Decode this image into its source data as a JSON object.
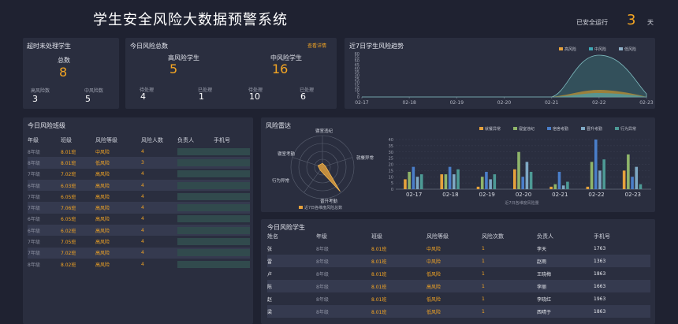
{
  "header": {
    "title": "学生安全风险大数据预警系统",
    "running_label": "已安全运行",
    "running_days": "3",
    "running_unit": "天"
  },
  "timeout": {
    "title": "超时未处理学生",
    "total_label": "总数",
    "total": "8",
    "high_label": "高风险数",
    "high": "3",
    "mid_label": "中风险数",
    "mid": "5"
  },
  "today_total": {
    "title": "今日风险总数",
    "detail_link": "查看详情",
    "high_label": "高风险学生",
    "high": "5",
    "mid_label": "中风险学生",
    "mid": "16",
    "high_pending_label": "待处理",
    "high_pending": "4",
    "high_done_label": "已处理",
    "high_done": "1",
    "mid_pending_label": "待处理",
    "mid_pending": "10",
    "mid_done_label": "已处理",
    "mid_done": "6"
  },
  "trend": {
    "title": "近7日学生风险趋势",
    "legend": [
      "高风险",
      "中风险",
      "低风险"
    ],
    "colors": [
      "#e6a23c",
      "#3fa7b5",
      "#8fb0c8"
    ],
    "x": [
      "02-17",
      "02-18",
      "02-19",
      "02-20",
      "02-21",
      "02-22",
      "02-23"
    ],
    "y_ticks": [
      "0",
      "5",
      "10",
      "15",
      "20",
      "25",
      "30",
      "35",
      "40",
      "45",
      "50",
      "55",
      "60"
    ]
  },
  "class_table": {
    "title": "今日风险班级",
    "headers": [
      "年级",
      "班级",
      "风险等级",
      "风险人数",
      "负责人",
      "手机号"
    ],
    "rows": [
      [
        "8年级",
        "8.01班",
        "中风险",
        "4"
      ],
      [
        "8年级",
        "8.01班",
        "低风险",
        "3"
      ],
      [
        "7年级",
        "7.02班",
        "高风险",
        "4"
      ],
      [
        "6年级",
        "6.03班",
        "高风险",
        "4"
      ],
      [
        "7年级",
        "6.05班",
        "高风险",
        "4"
      ],
      [
        "7年级",
        "7.06班",
        "高风险",
        "4"
      ],
      [
        "6年级",
        "6.05班",
        "高风险",
        "4"
      ],
      [
        "6年级",
        "6.02班",
        "高风险",
        "4"
      ],
      [
        "7年级",
        "7.05班",
        "高风险",
        "4"
      ],
      [
        "7年级",
        "7.02班",
        "高风险",
        "4"
      ],
      [
        "8年级",
        "8.02班",
        "高风险",
        "4"
      ]
    ]
  },
  "radar": {
    "title": "风险雷达",
    "axes": [
      "寝室违纪",
      "就餐异常",
      "晋升考勤",
      "行为异常",
      "寝室考勤"
    ],
    "legend": "近7日各维度风险总数"
  },
  "bar_chart": {
    "legend": [
      "就餐异常",
      "寝室违纪",
      "宿舍考勤",
      "晋升考勤",
      "行为异常"
    ],
    "colors": [
      "#e6a23c",
      "#8fb56a",
      "#4a7ec9",
      "#7ea9c4",
      "#4d9a95"
    ],
    "caption": "近7日各维度风险量"
  },
  "chart_data": {
    "type": "bar",
    "categories": [
      "02-17",
      "02-18",
      "02-19",
      "02-20",
      "02-21",
      "02-22",
      "02-23"
    ],
    "y_ticks": [
      "0",
      "5",
      "10",
      "15",
      "20",
      "25",
      "30",
      "35",
      "40"
    ],
    "ylim": [
      0,
      40
    ],
    "series": [
      {
        "name": "就餐异常",
        "values": [
          8,
          12,
          2,
          16,
          2,
          2,
          15
        ]
      },
      {
        "name": "寝室违纪",
        "values": [
          14,
          12,
          10,
          30,
          4,
          22,
          28
        ]
      },
      {
        "name": "宿舍考勤",
        "values": [
          18,
          18,
          14,
          10,
          14,
          40,
          10
        ]
      },
      {
        "name": "晋升考勤",
        "values": [
          10,
          12,
          8,
          22,
          3,
          15,
          18
        ]
      },
      {
        "name": "行为异常",
        "values": [
          12,
          16,
          12,
          14,
          6,
          24,
          4
        ]
      }
    ]
  },
  "student_table": {
    "title": "今日风险学生",
    "headers": [
      "姓名",
      "年级",
      "班级",
      "风险等级",
      "风险次数",
      "负责人",
      "手机号"
    ],
    "rows": [
      [
        "张",
        "8年级",
        "8.01班",
        "中风险",
        "1",
        "李天",
        "1763"
      ],
      [
        "雷",
        "8年级",
        "8.01班",
        "中风险",
        "1",
        "赵雨",
        "1363"
      ],
      [
        "卢",
        "8年级",
        "8.01班",
        "低风险",
        "1",
        "王晓梅",
        "1863"
      ],
      [
        "陈",
        "8年级",
        "8.01班",
        "高风险",
        "1",
        "李丽",
        "1663"
      ],
      [
        "赵",
        "8年级",
        "8.01班",
        "低风险",
        "1",
        "李晓红",
        "1963"
      ],
      [
        "梁",
        "8年级",
        "8.01班",
        "低风险",
        "1",
        "西晴于",
        "1863"
      ]
    ]
  }
}
